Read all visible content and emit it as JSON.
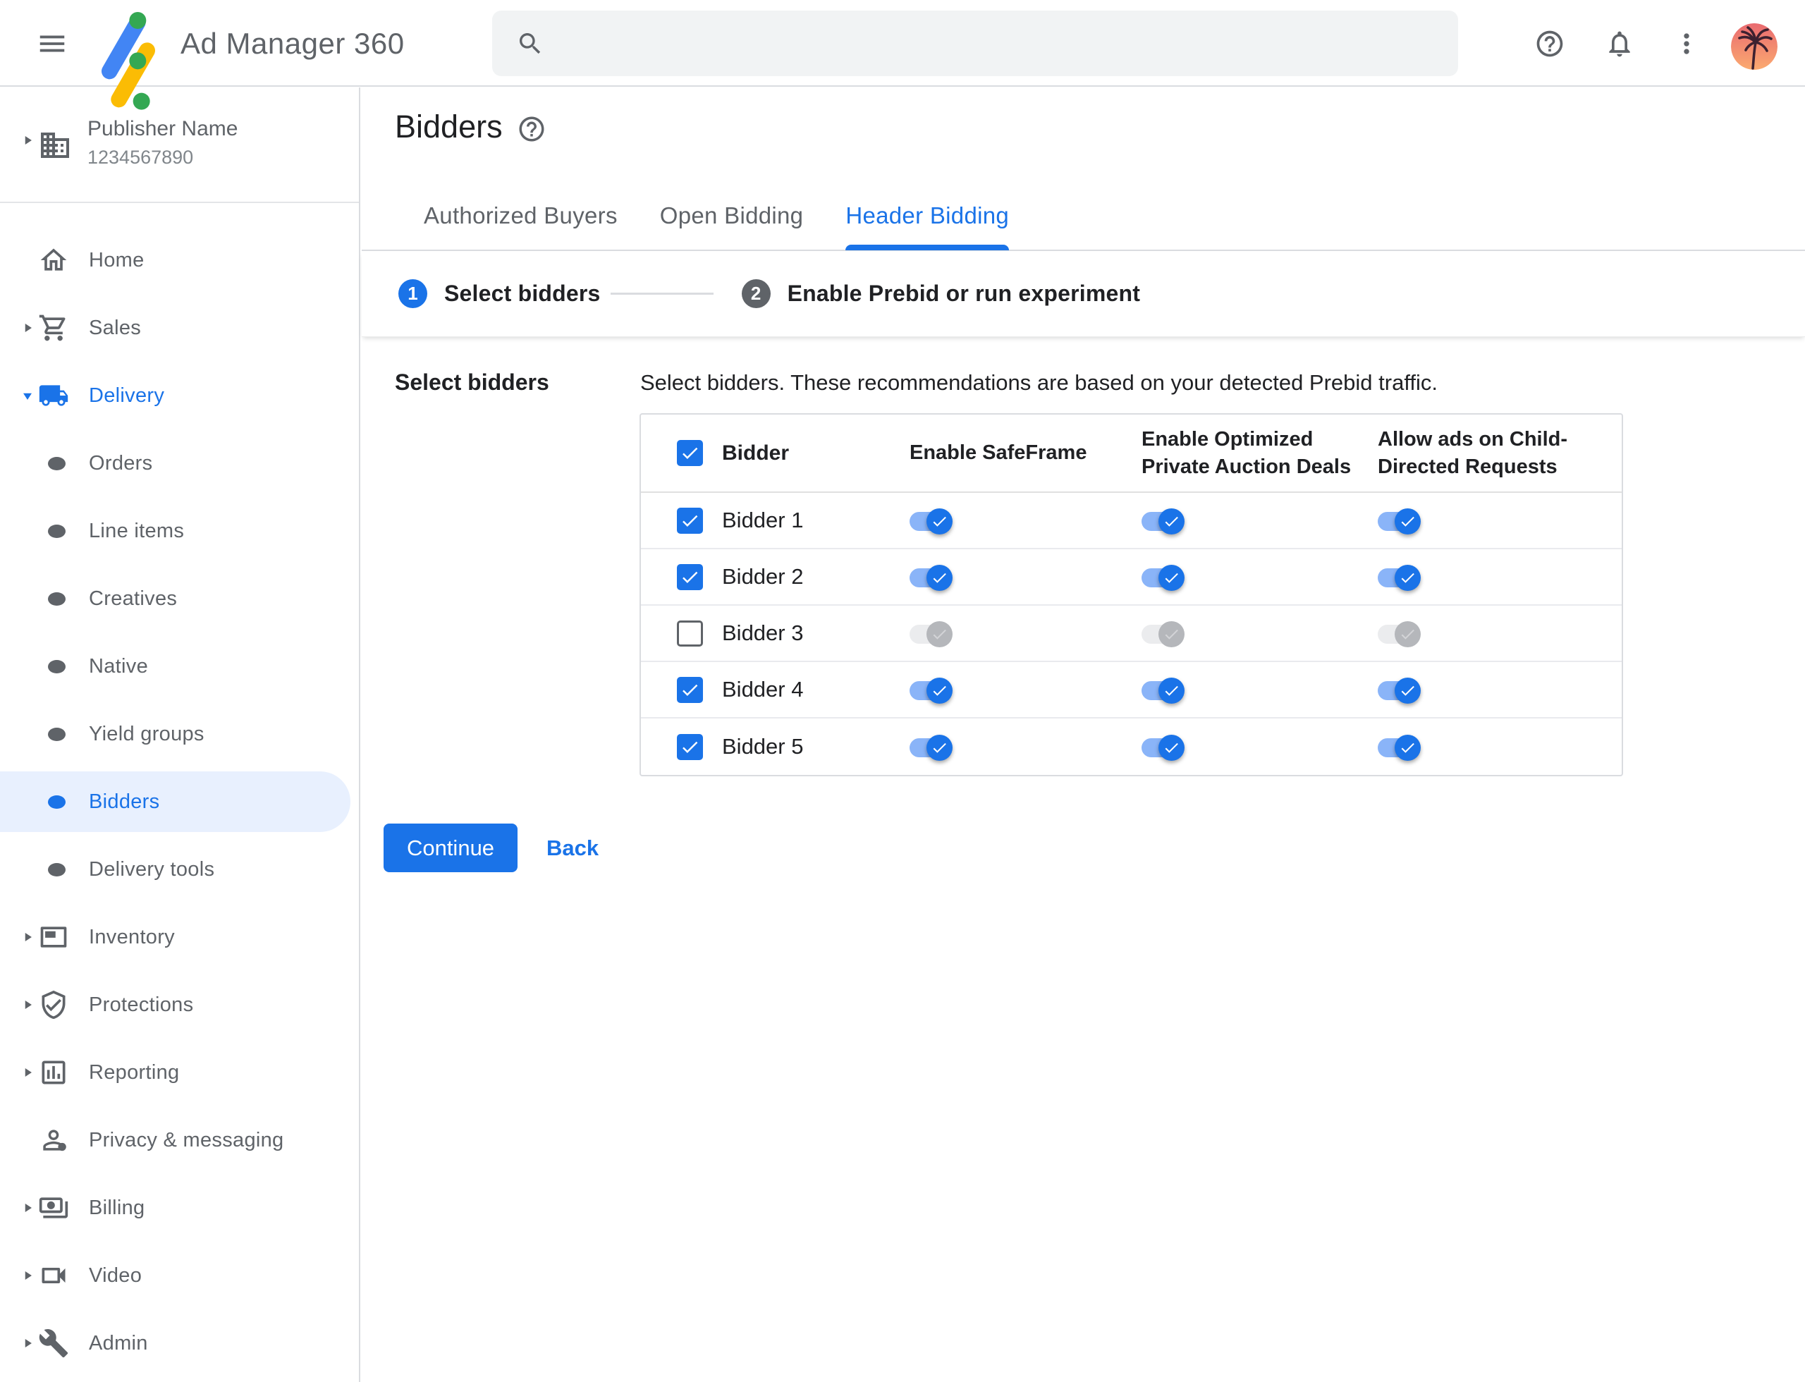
{
  "header": {
    "app_title": "Ad Manager 360",
    "search": {
      "value": "",
      "placeholder": ""
    }
  },
  "sidebar": {
    "publisher": {
      "name": "Publisher Name",
      "id": "1234567890"
    },
    "items": [
      {
        "label": "Home",
        "icon": "home-icon",
        "caret": null,
        "level": 0,
        "expanded": false,
        "selected": false
      },
      {
        "label": "Sales",
        "icon": "cart-icon",
        "caret": "right",
        "level": 0,
        "expanded": false,
        "selected": false
      },
      {
        "label": "Delivery",
        "icon": "truck-icon",
        "caret": "down",
        "level": 0,
        "expanded": true,
        "selected": false
      },
      {
        "label": "Orders",
        "icon": "bullet-icon",
        "caret": null,
        "level": 1,
        "expanded": false,
        "selected": false
      },
      {
        "label": "Line items",
        "icon": "bullet-icon",
        "caret": null,
        "level": 1,
        "expanded": false,
        "selected": false
      },
      {
        "label": "Creatives",
        "icon": "bullet-icon",
        "caret": null,
        "level": 1,
        "expanded": false,
        "selected": false
      },
      {
        "label": "Native",
        "icon": "bullet-icon",
        "caret": null,
        "level": 1,
        "expanded": false,
        "selected": false
      },
      {
        "label": "Yield groups",
        "icon": "bullet-icon",
        "caret": null,
        "level": 1,
        "expanded": false,
        "selected": false
      },
      {
        "label": "Bidders",
        "icon": "bullet-icon",
        "caret": null,
        "level": 1,
        "expanded": false,
        "selected": true
      },
      {
        "label": "Delivery tools",
        "icon": "bullet-icon",
        "caret": null,
        "level": 1,
        "expanded": false,
        "selected": false
      },
      {
        "label": "Inventory",
        "icon": "inventory-icon",
        "caret": "right",
        "level": 0,
        "expanded": false,
        "selected": false
      },
      {
        "label": "Protections",
        "icon": "shield-icon",
        "caret": "right",
        "level": 0,
        "expanded": false,
        "selected": false
      },
      {
        "label": "Reporting",
        "icon": "chart-icon",
        "caret": "right",
        "level": 0,
        "expanded": false,
        "selected": false
      },
      {
        "label": "Privacy & messaging",
        "icon": "person-dot-icon",
        "caret": null,
        "level": 0,
        "expanded": false,
        "selected": false
      },
      {
        "label": "Billing",
        "icon": "billing-icon",
        "caret": "right",
        "level": 0,
        "expanded": false,
        "selected": false
      },
      {
        "label": "Video",
        "icon": "video-icon",
        "caret": "right",
        "level": 0,
        "expanded": false,
        "selected": false
      },
      {
        "label": "Admin",
        "icon": "wrench-icon",
        "caret": "right",
        "level": 0,
        "expanded": false,
        "selected": false
      }
    ]
  },
  "main": {
    "page_title": "Bidders",
    "tabs": [
      {
        "label": "Authorized Buyers",
        "active": false
      },
      {
        "label": "Open Bidding",
        "active": false
      },
      {
        "label": "Header Bidding",
        "active": true
      }
    ],
    "steps": [
      {
        "number": "1",
        "label": "Select bidders",
        "active": true
      },
      {
        "number": "2",
        "label": "Enable Prebid or run experiment",
        "active": false
      }
    ],
    "section_label": "Select bidders",
    "description": "Select bidders. These recommendations are based on your detected Prebid traffic.",
    "table": {
      "columns": [
        "Bidder",
        "Enable SafeFrame",
        "Enable Optimized Private Auction Deals",
        "Allow ads on Child-Directed Requests"
      ],
      "header_checkbox_checked": true,
      "rows": [
        {
          "name": "Bidder 1",
          "checked": true,
          "toggles": [
            true,
            true,
            true
          ]
        },
        {
          "name": "Bidder 2",
          "checked": true,
          "toggles": [
            true,
            true,
            true
          ]
        },
        {
          "name": "Bidder 3",
          "checked": false,
          "toggles": [
            false,
            false,
            false
          ]
        },
        {
          "name": "Bidder 4",
          "checked": true,
          "toggles": [
            true,
            true,
            true
          ]
        },
        {
          "name": "Bidder 5",
          "checked": true,
          "toggles": [
            true,
            true,
            true
          ]
        }
      ]
    },
    "continue_label": "Continue",
    "back_label": "Back"
  },
  "colors": {
    "accent": "#1a73e8",
    "accent_light": "#8ab4f8",
    "selected_bg": "#e8f0fe",
    "border": "#dadce0",
    "row_border": "#e9eaee",
    "text_primary": "#202124",
    "text_secondary": "#5f6368",
    "text_tertiary": "#80868b",
    "search_bg": "#f1f3f4",
    "step_inactive": "#5f6368",
    "toggle_off_track": "#ebecee",
    "toggle_off_thumb": "#b5b7bb",
    "toggle_off_check": "#d3d4d7",
    "logo_blue": "#4285f4",
    "logo_yellow": "#fbbc04",
    "logo_green": "#34a853"
  }
}
